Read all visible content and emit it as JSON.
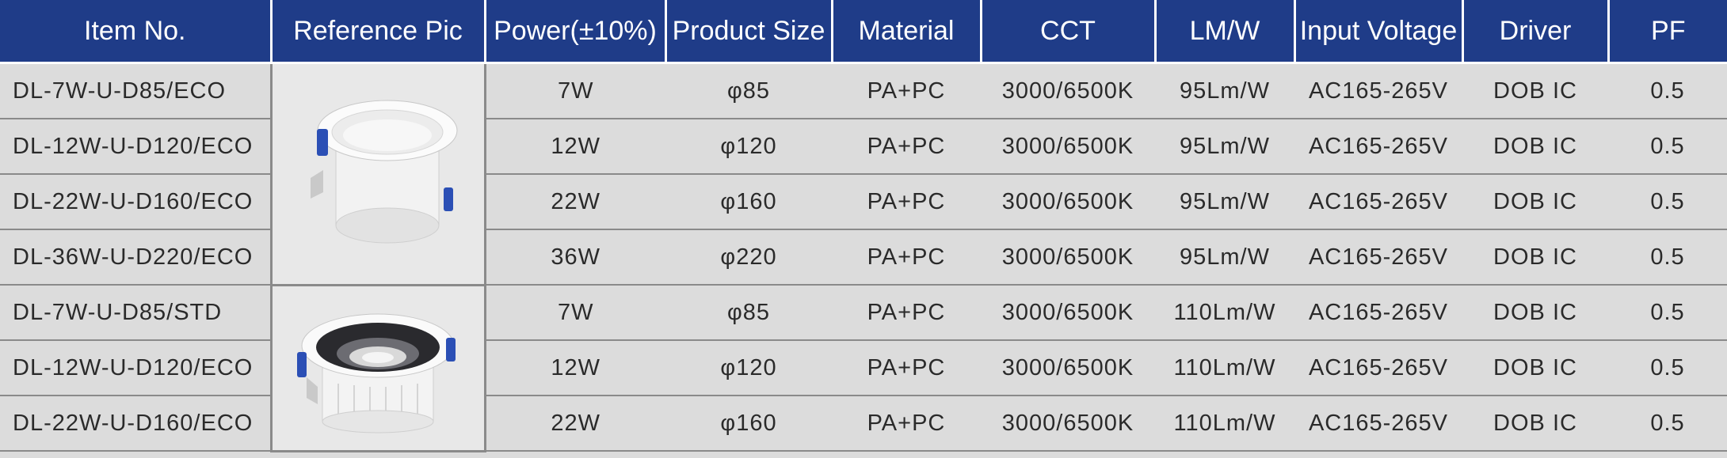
{
  "headers": [
    "Item No.",
    "Reference Pic",
    "Power(±10%)",
    "Product Size",
    "Material",
    "CCT",
    "LM/W",
    "Input Voltage",
    "Driver",
    "PF"
  ],
  "rows": [
    {
      "item": "DL-7W-U-D85/ECO",
      "power": "7W",
      "size": "φ85",
      "material": "PA+PC",
      "cct": "3000/6500K",
      "lmw": "95Lm/W",
      "voltage": "AC165-265V",
      "driver": "DOB IC",
      "pf": "0.5"
    },
    {
      "item": "DL-12W-U-D120/ECO",
      "power": "12W",
      "size": "φ120",
      "material": "PA+PC",
      "cct": "3000/6500K",
      "lmw": "95Lm/W",
      "voltage": "AC165-265V",
      "driver": "DOB IC",
      "pf": "0.5"
    },
    {
      "item": "DL-22W-U-D160/ECO",
      "power": "22W",
      "size": "φ160",
      "material": "PA+PC",
      "cct": "3000/6500K",
      "lmw": "95Lm/W",
      "voltage": "AC165-265V",
      "driver": "DOB IC",
      "pf": "0.5"
    },
    {
      "item": "DL-36W-U-D220/ECO",
      "power": "36W",
      "size": "φ220",
      "material": "PA+PC",
      "cct": "3000/6500K",
      "lmw": "95Lm/W",
      "voltage": "AC165-265V",
      "driver": "DOB IC",
      "pf": "0.5"
    },
    {
      "item": "DL-7W-U-D85/STD",
      "power": "7W",
      "size": "φ85",
      "material": "PA+PC",
      "cct": "3000/6500K",
      "lmw": "110Lm/W",
      "voltage": "AC165-265V",
      "driver": "DOB IC",
      "pf": "0.5"
    },
    {
      "item": "DL-12W-U-D120/ECO",
      "power": "12W",
      "size": "φ120",
      "material": "PA+PC",
      "cct": "3000/6500K",
      "lmw": "110Lm/W",
      "voltage": "AC165-265V",
      "driver": "DOB IC",
      "pf": "0.5"
    },
    {
      "item": "DL-22W-U-D160/ECO",
      "power": "22W",
      "size": "φ160",
      "material": "PA+PC",
      "cct": "3000/6500K",
      "lmw": "110Lm/W",
      "voltage": "AC165-265V",
      "driver": "DOB IC",
      "pf": "0.5"
    }
  ],
  "pictures": [
    {
      "icon": "white-downlight-icon",
      "description_hidden": false
    },
    {
      "icon": "black-reflector-downlight-icon",
      "description_hidden": false
    }
  ],
  "colors": {
    "header_bg": "#1f3c88",
    "row_bg": "#dcdcdc",
    "clip_blue": "#2b4fb5"
  }
}
